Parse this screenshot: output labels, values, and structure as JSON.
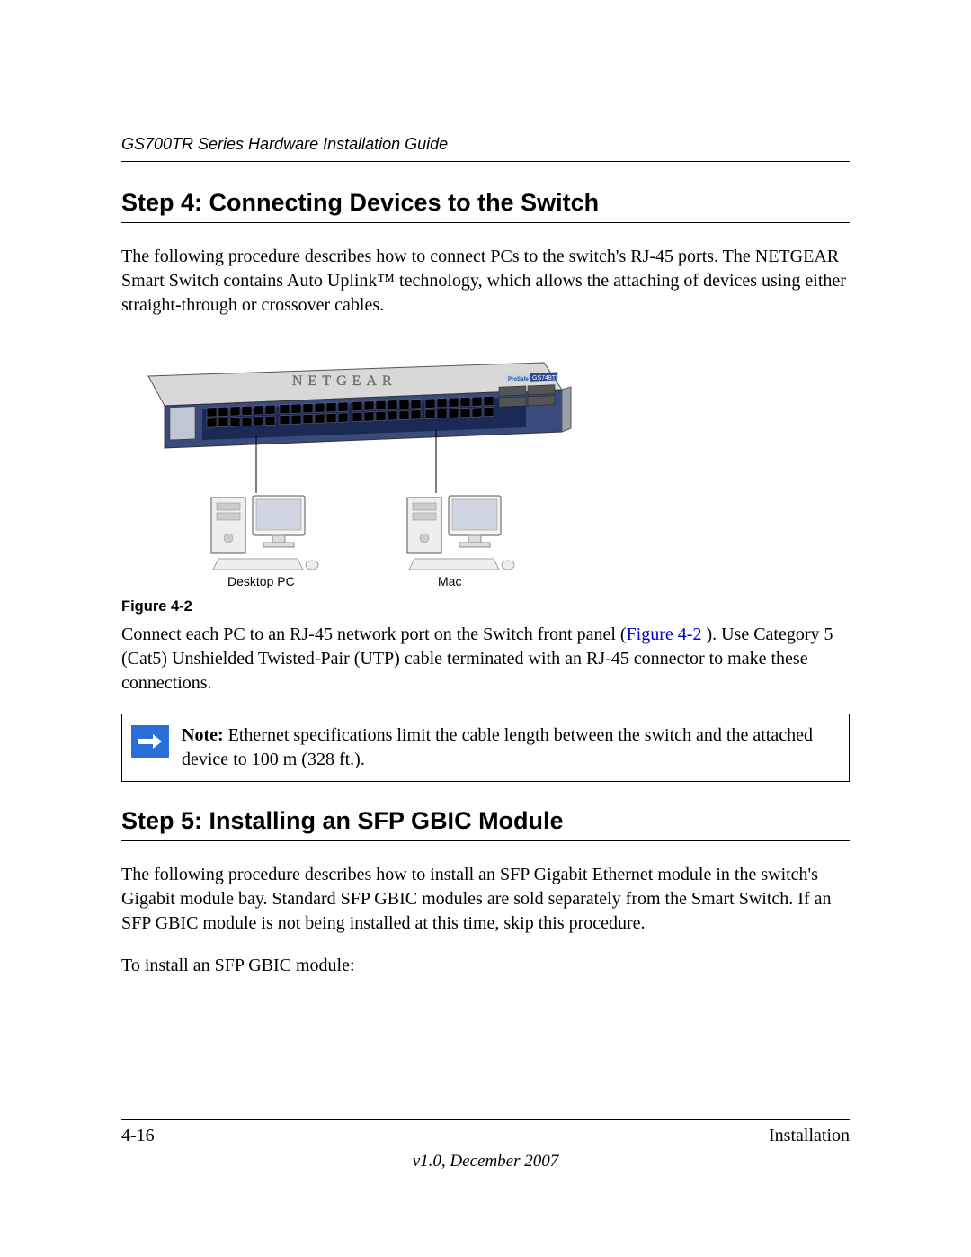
{
  "header": {
    "running_title": "GS700TR Series Hardware Installation Guide"
  },
  "section1": {
    "heading": "Step 4: Connecting Devices to the Switch",
    "intro": "The following procedure describes how to connect PCs to the switch's RJ-45 ports. The NETGEAR Smart Switch contains Auto Uplink™ technology, which allows the attaching of devices using either straight-through or crossover cables.",
    "figure": {
      "brand": "NETGEAR",
      "model_prefix": "ProSafe",
      "model": "GS748TR",
      "label_left": "Desktop PC",
      "label_right": "Mac",
      "caption": "Figure 4-2"
    },
    "after_figure_pre": "Connect each PC to an RJ-45 network port on the Switch front panel (",
    "after_figure_ref": "Figure 4-2",
    "after_figure_post": " ). Use Category 5 (Cat5) Unshielded Twisted-Pair (UTP) cable terminated with an RJ-45 connector to make these connections.",
    "note": {
      "label": "Note:",
      "text": " Ethernet specifications limit the cable length between the switch and the attached device to 100 m (328 ft.)."
    }
  },
  "section2": {
    "heading": "Step 5: Installing an SFP GBIC Module",
    "p1": "The following procedure describes how to install an SFP Gigabit Ethernet module in the switch's Gigabit module bay. Standard SFP GBIC modules are sold separately from the Smart Switch. If an SFP GBIC module is not being installed at this time, skip this procedure.",
    "p2": "To install an SFP GBIC module:"
  },
  "footer": {
    "page": "4-16",
    "chapter": "Installation",
    "version": "v1.0, December 2007"
  }
}
